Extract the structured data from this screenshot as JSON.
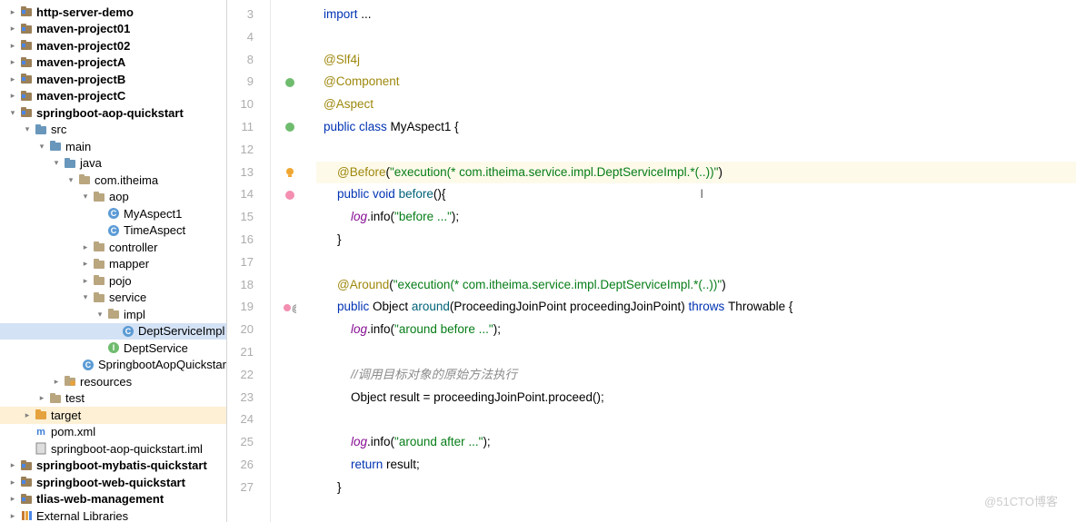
{
  "sidebar": {
    "items": [
      {
        "indent": 0,
        "arrow": "right",
        "icon": "module",
        "label": "http-server-demo",
        "bold": true
      },
      {
        "indent": 0,
        "arrow": "right",
        "icon": "module",
        "label": "maven-project01",
        "bold": true
      },
      {
        "indent": 0,
        "arrow": "right",
        "icon": "module",
        "label": "maven-project02",
        "bold": true
      },
      {
        "indent": 0,
        "arrow": "right",
        "icon": "module",
        "label": "maven-projectA",
        "bold": true
      },
      {
        "indent": 0,
        "arrow": "right",
        "icon": "module",
        "label": "maven-projectB",
        "bold": true
      },
      {
        "indent": 0,
        "arrow": "right",
        "icon": "module",
        "label": "maven-projectC",
        "bold": true
      },
      {
        "indent": 0,
        "arrow": "down",
        "icon": "module",
        "label": "springboot-aop-quickstart",
        "bold": true
      },
      {
        "indent": 1,
        "arrow": "down",
        "icon": "folder-blue",
        "label": "src",
        "bold": false
      },
      {
        "indent": 2,
        "arrow": "down",
        "icon": "folder-blue",
        "label": "main",
        "bold": false
      },
      {
        "indent": 3,
        "arrow": "down",
        "icon": "folder-blue",
        "label": "java",
        "bold": false
      },
      {
        "indent": 4,
        "arrow": "down",
        "icon": "folder",
        "label": "com.itheima",
        "bold": false
      },
      {
        "indent": 5,
        "arrow": "down",
        "icon": "folder",
        "label": "aop",
        "bold": false
      },
      {
        "indent": 6,
        "arrow": "none",
        "icon": "class",
        "label": "MyAspect1",
        "bold": false
      },
      {
        "indent": 6,
        "arrow": "none",
        "icon": "class",
        "label": "TimeAspect",
        "bold": false
      },
      {
        "indent": 5,
        "arrow": "right",
        "icon": "folder",
        "label": "controller",
        "bold": false
      },
      {
        "indent": 5,
        "arrow": "right",
        "icon": "folder",
        "label": "mapper",
        "bold": false
      },
      {
        "indent": 5,
        "arrow": "right",
        "icon": "folder",
        "label": "pojo",
        "bold": false
      },
      {
        "indent": 5,
        "arrow": "down",
        "icon": "folder",
        "label": "service",
        "bold": false
      },
      {
        "indent": 6,
        "arrow": "down",
        "icon": "folder",
        "label": "impl",
        "bold": false
      },
      {
        "indent": 7,
        "arrow": "none",
        "icon": "class",
        "label": "DeptServiceImpl",
        "bold": false,
        "selected": true
      },
      {
        "indent": 6,
        "arrow": "none",
        "icon": "interface",
        "label": "DeptService",
        "bold": false
      },
      {
        "indent": 5,
        "arrow": "none",
        "icon": "class",
        "label": "SpringbootAopQuickstartA",
        "bold": false
      },
      {
        "indent": 3,
        "arrow": "right",
        "icon": "folder-teal",
        "label": "resources",
        "bold": false
      },
      {
        "indent": 2,
        "arrow": "right",
        "icon": "folder",
        "label": "test",
        "bold": false
      },
      {
        "indent": 1,
        "arrow": "right",
        "icon": "folder-orange",
        "label": "target",
        "bold": false,
        "highlight": true
      },
      {
        "indent": 1,
        "arrow": "none",
        "icon": "pom",
        "label": "pom.xml",
        "bold": false
      },
      {
        "indent": 1,
        "arrow": "none",
        "icon": "iml",
        "label": "springboot-aop-quickstart.iml",
        "bold": false
      },
      {
        "indent": 0,
        "arrow": "right",
        "icon": "module",
        "label": "springboot-mybatis-quickstart",
        "bold": true
      },
      {
        "indent": 0,
        "arrow": "right",
        "icon": "module",
        "label": "springboot-web-quickstart",
        "bold": true
      },
      {
        "indent": 0,
        "arrow": "right",
        "icon": "module",
        "label": "tlias-web-management",
        "bold": true
      },
      {
        "indent": 0,
        "arrow": "right",
        "icon": "lib",
        "label": "External Libraries",
        "bold": false
      }
    ]
  },
  "editor": {
    "gutter_start": 3,
    "gutter_icons": {
      "9": "bean",
      "11": "bean",
      "13": "bulb",
      "14": "overlay",
      "19": "overlay_at"
    },
    "lines": [
      {
        "n": 3,
        "html": [
          [
            "kw",
            "import "
          ],
          [
            "ident",
            "..."
          ]
        ]
      },
      {
        "n": 4,
        "html": []
      },
      {
        "n": 5,
        "skip": true
      },
      {
        "n": 6,
        "skip": true
      },
      {
        "n": 7,
        "skip": true
      },
      {
        "n": 8,
        "html": [
          [
            "anno",
            "@Slf4j"
          ]
        ]
      },
      {
        "n": 9,
        "html": [
          [
            "anno",
            "@Component"
          ]
        ]
      },
      {
        "n": 10,
        "html": [
          [
            "anno",
            "@Aspect"
          ]
        ]
      },
      {
        "n": 11,
        "html": [
          [
            "kw",
            "public class "
          ],
          [
            "ident",
            "MyAspect1 {"
          ]
        ]
      },
      {
        "n": 12,
        "html": []
      },
      {
        "n": 13,
        "html": [
          [
            "sp",
            "    "
          ],
          [
            "anno",
            "@Before"
          ],
          [
            "ident",
            "("
          ],
          [
            "str",
            "\"execution(* com.itheima.service.impl.DeptServiceImpl.*(..))\""
          ],
          [
            "ident",
            ")"
          ]
        ],
        "hl": true
      },
      {
        "n": 14,
        "html": [
          [
            "sp",
            "    "
          ],
          [
            "kw",
            "public void "
          ],
          [
            "method",
            "before"
          ],
          [
            "ident",
            "(){"
          ]
        ],
        "cursor": true
      },
      {
        "n": 15,
        "html": [
          [
            "sp",
            "        "
          ],
          [
            "field",
            "log"
          ],
          [
            "ident",
            ".info("
          ],
          [
            "str",
            "\"before ...\""
          ],
          [
            "ident",
            ");"
          ]
        ]
      },
      {
        "n": 16,
        "html": [
          [
            "sp",
            "    "
          ],
          [
            "ident",
            "}"
          ]
        ]
      },
      {
        "n": 17,
        "html": []
      },
      {
        "n": 18,
        "html": [
          [
            "sp",
            "    "
          ],
          [
            "anno",
            "@Around"
          ],
          [
            "ident",
            "("
          ],
          [
            "str",
            "\"execution(* com.itheima.service.impl.DeptServiceImpl.*(..))\""
          ],
          [
            "ident",
            ")"
          ]
        ]
      },
      {
        "n": 19,
        "html": [
          [
            "sp",
            "    "
          ],
          [
            "kw",
            "public "
          ],
          [
            "ident",
            "Object "
          ],
          [
            "method",
            "around"
          ],
          [
            "ident",
            "(ProceedingJoinPoint proceedingJoinPoint) "
          ],
          [
            "kw",
            "throws "
          ],
          [
            "ident",
            "Throwable {"
          ]
        ]
      },
      {
        "n": 20,
        "html": [
          [
            "sp",
            "        "
          ],
          [
            "field",
            "log"
          ],
          [
            "ident",
            ".info("
          ],
          [
            "str",
            "\"around before ...\""
          ],
          [
            "ident",
            ");"
          ]
        ]
      },
      {
        "n": 21,
        "html": []
      },
      {
        "n": 22,
        "html": [
          [
            "sp",
            "        "
          ],
          [
            "cmt",
            "//调用目标对象的原始方法执行"
          ]
        ]
      },
      {
        "n": 23,
        "html": [
          [
            "sp",
            "        "
          ],
          [
            "ident",
            "Object result = proceedingJoinPoint.proceed();"
          ]
        ]
      },
      {
        "n": 24,
        "html": []
      },
      {
        "n": 25,
        "html": [
          [
            "sp",
            "        "
          ],
          [
            "field",
            "log"
          ],
          [
            "ident",
            ".info("
          ],
          [
            "str",
            "\"around after ...\""
          ],
          [
            "ident",
            ");"
          ]
        ]
      },
      {
        "n": 26,
        "html": [
          [
            "sp",
            "        "
          ],
          [
            "kw",
            "return "
          ],
          [
            "ident",
            "result;"
          ]
        ]
      },
      {
        "n": 27,
        "html": [
          [
            "sp",
            "    "
          ],
          [
            "ident",
            "}"
          ]
        ]
      }
    ]
  },
  "watermark": "@51CTO博客"
}
